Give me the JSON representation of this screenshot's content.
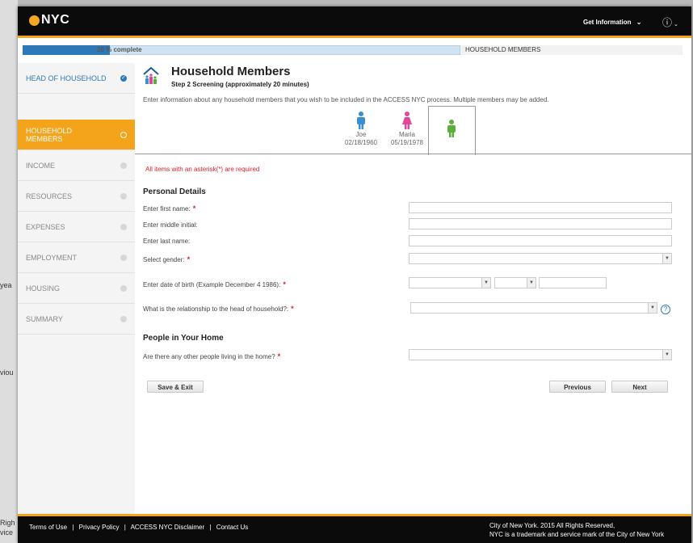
{
  "background_text": {
    "yea": "yea",
    "viou": "viou",
    "righ": "Righ",
    "vice": "vice"
  },
  "header": {
    "logo": "NYC",
    "get_information": "Get Information",
    "help_icon": "question-circle-icon"
  },
  "progress": {
    "percent": 20,
    "label": "20 % complete",
    "breadcrumb": "HOUSEHOLD MEMBERS"
  },
  "sidebar": {
    "items": [
      {
        "label": "HEAD OF HOUSEHOLD",
        "status": "complete"
      },
      {
        "label": "HOUSEHOLD MEMBERS",
        "status": "active"
      },
      {
        "label": "INCOME",
        "status": "pending"
      },
      {
        "label": "RESOURCES",
        "status": "pending"
      },
      {
        "label": "EXPENSES",
        "status": "pending"
      },
      {
        "label": "EMPLOYMENT",
        "status": "pending"
      },
      {
        "label": "HOUSING",
        "status": "pending"
      },
      {
        "label": "SUMMARY",
        "status": "pending"
      }
    ]
  },
  "page": {
    "title": "Household Members",
    "subtitle": "Step 2 Screening (approximately 20 minutes)",
    "intro": "Enter information about any household members that you wish to be included in the ACCESS NYC process. Multiple members may be added.",
    "members": [
      {
        "name": "Joe",
        "dob": "02/18/1960",
        "color": "#3a8fcf"
      },
      {
        "name": "Maria",
        "dob": "05/19/1978",
        "color": "#e0479a"
      },
      {
        "name": "",
        "dob": "",
        "color": "#5cae3a"
      }
    ],
    "required_note": "All items with an asterisk(*) are required"
  },
  "form": {
    "personal_heading": "Personal Details",
    "first_name_label": "Enter first name:",
    "first_name_value": "",
    "middle_initial_label": "Enter middle initial:",
    "middle_initial_value": "",
    "last_name_label": "Enter last name:",
    "last_name_value": "",
    "gender_label": "Select gender:",
    "gender_value": "",
    "dob_label": "Enter date of birth (Example December 4 1986):",
    "dob_month": "",
    "dob_day": "",
    "dob_year": "",
    "relationship_label": "What is the relationship to the head of household?:",
    "relationship_value": "",
    "people_heading": "People in Your Home",
    "other_people_label": "Are there any other people living in the home?",
    "other_people_value": ""
  },
  "buttons": {
    "save_exit": "Save & Exit",
    "previous": "Previous",
    "next": "Next"
  },
  "footer": {
    "terms": "Terms of Use",
    "privacy": "Privacy Policy",
    "disclaimer": "ACCESS NYC Disclaimer",
    "contact": "Contact Us",
    "separator": "|",
    "copyright": "City of New York. 2015 All Rights Reserved,",
    "trademark": "NYC is a trademark and service mark of the City of New York"
  },
  "colors": {
    "brand_orange": "#f3a41a",
    "brand_blue": "#2d79b7",
    "required_red": "#d9242d"
  }
}
